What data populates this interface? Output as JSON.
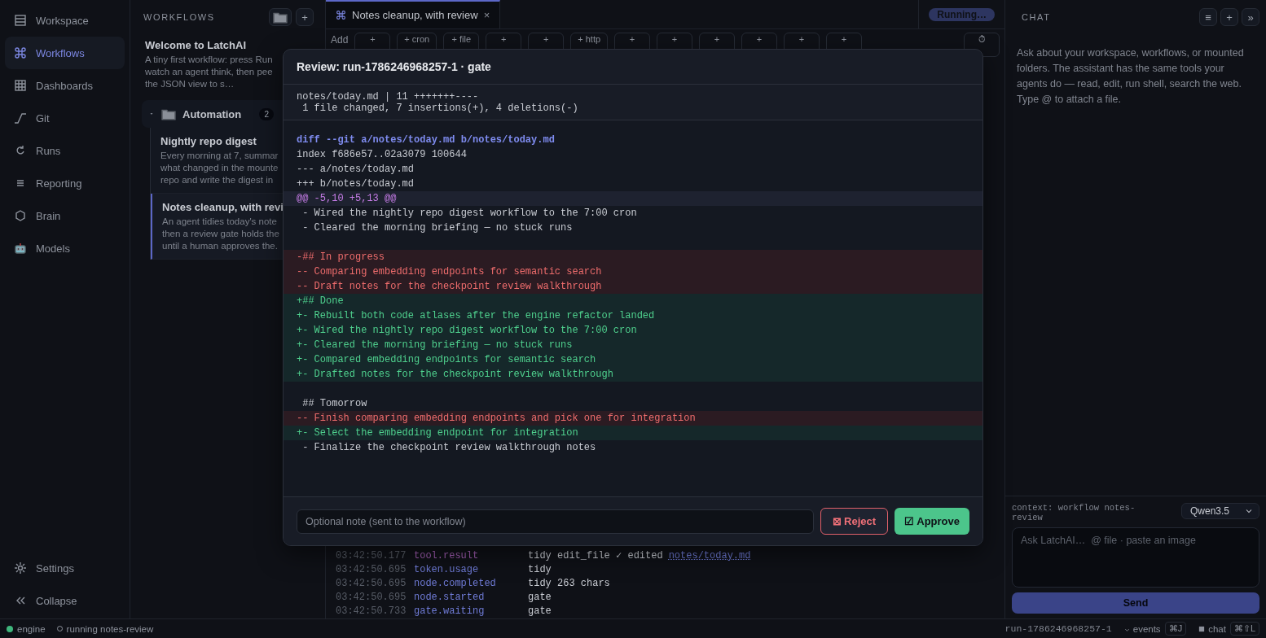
{
  "nav": {
    "items": [
      {
        "label": "Workspace",
        "selected": false
      },
      {
        "label": "Workflows",
        "selected": true
      },
      {
        "label": "Dashboards",
        "selected": false
      },
      {
        "label": "Git",
        "selected": false
      },
      {
        "label": "Runs",
        "selected": false
      },
      {
        "label": "Reporting",
        "selected": false
      },
      {
        "label": "Brain",
        "selected": false
      },
      {
        "label": "Models",
        "selected": false
      }
    ],
    "bottom": [
      {
        "label": "Settings"
      },
      {
        "label": "Collapse"
      }
    ]
  },
  "workflows": {
    "title": "WORKFLOWS",
    "add_button": "+",
    "welcome": {
      "title": "Welcome to LatchAI",
      "lines": [
        "A tiny first workflow: press Run",
        "watch an agent think, then pee",
        "the JSON view to s…"
      ]
    },
    "groups": [
      {
        "name": "Automation",
        "count": "2",
        "expanded": true,
        "items": [
          {
            "title": "Nightly repo digest",
            "lines": [
              "Every morning at 7, summar",
              "what changed in the mounte",
              "repo and write the digest in"
            ],
            "selected": false
          },
          {
            "title": "Notes cleanup, with revi",
            "lines": [
              "An agent tidies today's note",
              "then a review gate holds the",
              "until a human approves the."
            ],
            "selected": true
          }
        ]
      }
    ]
  },
  "editor": {
    "tab": {
      "label": "Notes cleanup, with review",
      "close": "×"
    },
    "status": "Running…",
    "toolbar": {
      "label": "Add",
      "buttons": [
        "+",
        "+ cron",
        "+ file",
        "+",
        "+",
        "+ http",
        "+",
        "+",
        "+",
        "+",
        "+",
        "+"
      ],
      "history": "⏱"
    },
    "events": [
      {
        "time": "03:42:50.177",
        "event": "tool.result",
        "kind": "tool",
        "message": "tidy edit_file ✓ edited",
        "link": "notes/today.md"
      },
      {
        "time": "03:42:50.695",
        "event": "token.usage",
        "kind": "node",
        "message": "tidy"
      },
      {
        "time": "03:42:50.695",
        "event": "node.completed",
        "kind": "node",
        "message": "tidy 263 chars"
      },
      {
        "time": "03:42:50.695",
        "event": "node.started",
        "kind": "node",
        "message": "gate"
      },
      {
        "time": "03:42:50.733",
        "event": "gate.waiting",
        "kind": "node",
        "message": "gate"
      }
    ]
  },
  "review_dialog": {
    "title": "Review: run-1786246968257-1 · gate",
    "stat": [
      "notes/today.md | 11 +++++++----",
      " 1 file changed, 7 insertions(+), 4 deletions(-)"
    ],
    "diff": [
      {
        "kind": "file",
        "text": "diff --git a/notes/today.md b/notes/today.md"
      },
      {
        "kind": "meta",
        "text": "index f686e57..02a3079 100644"
      },
      {
        "kind": "meta",
        "text": "--- a/notes/today.md"
      },
      {
        "kind": "meta",
        "text": "+++ b/notes/today.md"
      },
      {
        "kind": "hunk",
        "text": "@@ -5,10 +5,13 @@"
      },
      {
        "kind": "context",
        "text": " - Wired the nightly repo digest workflow to the 7:00 cron"
      },
      {
        "kind": "context",
        "text": " - Cleared the morning briefing — no stuck runs"
      },
      {
        "kind": "blank"
      },
      {
        "kind": "del",
        "text": "-## In progress"
      },
      {
        "kind": "del",
        "text": "-- Comparing embedding endpoints for semantic search"
      },
      {
        "kind": "del",
        "text": "-- Draft notes for the checkpoint review walkthrough"
      },
      {
        "kind": "add",
        "text": "+## Done"
      },
      {
        "kind": "add",
        "text": "+- Rebuilt both code atlases after the engine refactor landed"
      },
      {
        "kind": "add",
        "text": "+- Wired the nightly repo digest workflow to the 7:00 cron"
      },
      {
        "kind": "add",
        "text": "+- Cleared the morning briefing — no stuck runs"
      },
      {
        "kind": "add",
        "text": "+- Compared embedding endpoints for semantic search"
      },
      {
        "kind": "add",
        "text": "+- Drafted notes for the checkpoint review walkthrough"
      },
      {
        "kind": "blank"
      },
      {
        "kind": "context",
        "text": " ## Tomorrow"
      },
      {
        "kind": "del",
        "text": "-- Finish comparing embedding endpoints and pick one for integration"
      },
      {
        "kind": "add",
        "text": "+- Select the embedding endpoint for integration"
      },
      {
        "kind": "context",
        "text": " - Finalize the checkpoint review walkthrough notes"
      }
    ],
    "note": {
      "placeholder": "Optional note (sent to the workflow)"
    },
    "reject": "⊠ Reject",
    "approve": "☑ Approve"
  },
  "chat": {
    "title": "CHAT",
    "buttons": [
      "≡",
      "+",
      "»"
    ],
    "intro": "Ask about your workspace, workflows, or mounted folders. The assistant has the same tools your agents do — read, edit, run shell, search the web. Type @ to attach a file.",
    "context": "context: workflow notes-review",
    "model": "Qwen3.5",
    "input": {
      "placeholder": "Ask LatchAI…  @ file · paste an image"
    },
    "send": "Send"
  },
  "status_bar": {
    "left": [
      {
        "kind": "dot",
        "label": "engine",
        "color": "#3fb67c"
      },
      {
        "kind": "ring",
        "label": "running notes-review"
      }
    ],
    "run": "run-1786246968257-1",
    "toggles": [
      {
        "label": "events",
        "shortcut": "⌘J"
      },
      {
        "label": "chat",
        "shortcut": "⌘⇧L"
      }
    ]
  }
}
